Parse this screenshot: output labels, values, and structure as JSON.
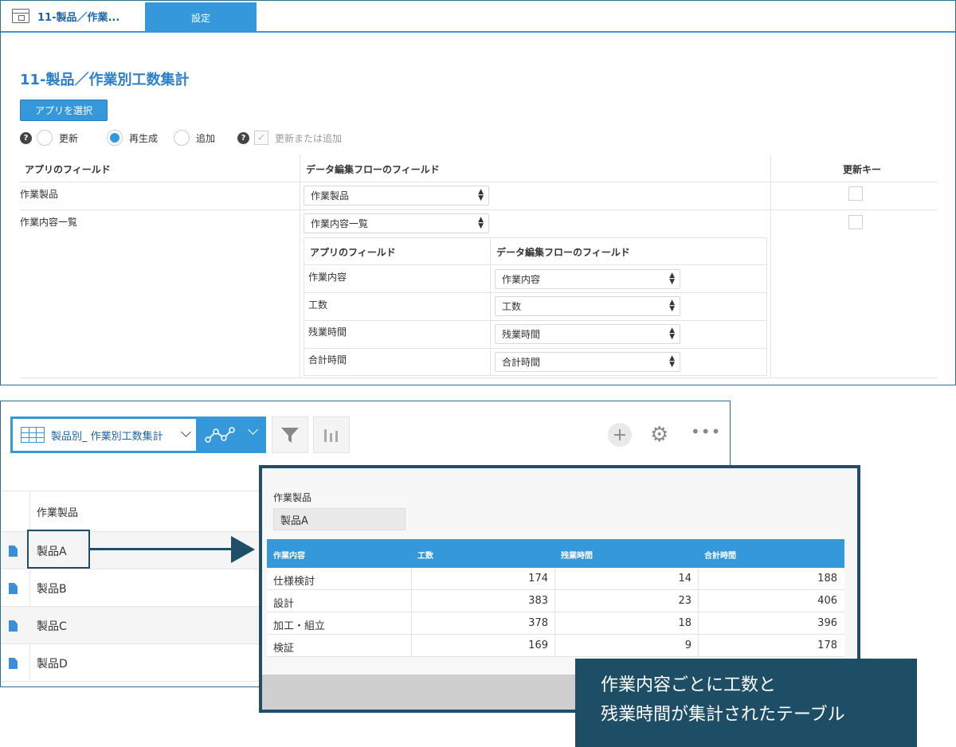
{
  "tabs": {
    "app_title": "11-製品／作業...",
    "settings_label": "設定"
  },
  "page": {
    "title": "11-製品／作業別工数集計",
    "select_app_button": "アプリを選択"
  },
  "options": {
    "update": "更新",
    "regenerate": "再生成",
    "add": "追加",
    "update_or_add": "更新または追加",
    "selected": "regenerate"
  },
  "mapping": {
    "headers": {
      "app_field": "アプリのフィールド",
      "flow_field": "データ編集フローのフィールド",
      "update_key": "更新キー"
    },
    "rows": [
      {
        "app_field": "作業製品",
        "flow_field": "作業製品"
      },
      {
        "app_field": "作業内容一覧",
        "flow_field": "作業内容一覧"
      }
    ],
    "sub_headers": {
      "app_field": "アプリのフィールド",
      "flow_field": "データ編集フローのフィールド"
    },
    "sub_rows": [
      {
        "app_field": "作業内容",
        "flow_field": "作業内容"
      },
      {
        "app_field": "工数",
        "flow_field": "工数"
      },
      {
        "app_field": "残業時間",
        "flow_field": "残業時間"
      },
      {
        "app_field": "合計時間",
        "flow_field": "合計時間"
      }
    ]
  },
  "view": {
    "name": "製品別_ 作業別工数集計"
  },
  "record_list": {
    "header": "作業製品",
    "items": [
      "製品A",
      "製品B",
      "製品C",
      "製品D"
    ]
  },
  "detail": {
    "field_label": "作業製品",
    "field_value": "製品A",
    "table_headers": [
      "作業内容",
      "工数",
      "残業時間",
      "合計時間"
    ],
    "table_rows": [
      [
        "仕様検討",
        "174",
        "14",
        "188"
      ],
      [
        "設計",
        "383",
        "23",
        "406"
      ],
      [
        "加工・組立",
        "378",
        "18",
        "396"
      ],
      [
        "検証",
        "169",
        "9",
        "178"
      ]
    ]
  },
  "callout": {
    "line1": "作業内容ごとに工数と",
    "line2": "残業時間が集計されたテーブル"
  },
  "colors": {
    "accent": "#3498db",
    "dark_navy": "#1e4d66"
  }
}
